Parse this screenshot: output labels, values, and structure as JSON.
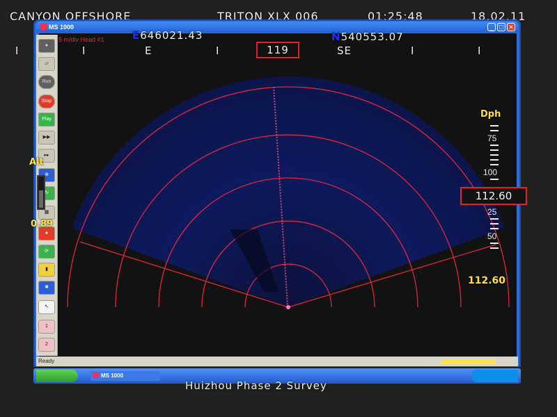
{
  "overlay": {
    "company": "CANYON OFFSHORE",
    "vehicle": "TRITON XLX 006",
    "time": "01:25:48",
    "date": "18.02.11",
    "easting_prefix": "E",
    "easting": "646021.43",
    "northing_prefix": "N",
    "northing": "540553.07",
    "footer": "Huizhou Phase 2 Survey"
  },
  "compass": {
    "marks": [
      "I",
      "I",
      "E",
      "I",
      "119",
      "SE",
      "I",
      "I"
    ],
    "heading": "119"
  },
  "window": {
    "app_title": "MS 1000",
    "scale_label": "5 m/div Head #1",
    "status_text": "Ready",
    "taskbar_item": "MS 1000"
  },
  "toolbar": {
    "buttons": [
      "",
      "",
      "Run",
      "Stop",
      "Play",
      "",
      "",
      "",
      "",
      "",
      "",
      "",
      "",
      "",
      "",
      "",
      "",
      ""
    ]
  },
  "altimeter": {
    "label": "Alt",
    "value": "0.89",
    "level": 0.55
  },
  "depth": {
    "label": "Dph",
    "ticks": [
      "75",
      "100",
      "25",
      "50"
    ],
    "current": "112.60",
    "bottom_readout": "112.60"
  },
  "colors": {
    "sonar_ring": "#e0283c",
    "sonar_fill": "#0b1552",
    "warning_box": "#e8202a",
    "readout_yellow": "#ffe04a",
    "window_blue": "#2a6fd8"
  }
}
